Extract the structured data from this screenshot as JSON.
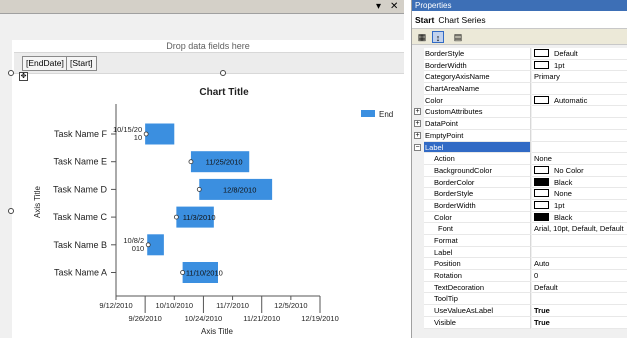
{
  "designer": {
    "drop_zone_text": "Drop data fields here",
    "fields": [
      "[EndDate]",
      "[Start]"
    ],
    "topbar_icons": {
      "dropdown": "▾",
      "close": "✕"
    }
  },
  "chart_data": {
    "type": "bar",
    "title": "Chart Title",
    "xlabel": "Axis Title",
    "ylabel": "Axis Title",
    "legend": {
      "position": "top-right",
      "entries": [
        "End"
      ]
    },
    "categories": [
      "Task Name F",
      "Task Name E",
      "Task Name D",
      "Task Name C",
      "Task Name B",
      "Task Name A"
    ],
    "series": [
      {
        "name": "End",
        "color": "#3b8fe0",
        "ranges": [
          {
            "start": "2010-09-26",
            "end": "2010-10-10",
            "label": "10/15/20\n10"
          },
          {
            "start": "2010-10-18",
            "end": "2010-11-15",
            "label": "11/25/2010"
          },
          {
            "start": "2010-10-22",
            "end": "2010-11-26",
            "label": "12/8/2010"
          },
          {
            "start": "2010-10-11",
            "end": "2010-10-29",
            "label": "11/3/2010"
          },
          {
            "start": "2010-09-27",
            "end": "2010-10-05",
            "label": "10/8/2\n010"
          },
          {
            "start": "2010-10-14",
            "end": "2010-10-31",
            "label": "11/10/2010"
          }
        ]
      }
    ],
    "x_ticks_top": [
      "9/12/2010",
      "10/10/2010",
      "11/7/2010",
      "12/5/2010"
    ],
    "x_ticks_bottom": [
      "9/26/2010",
      "10/24/2010",
      "11/21/2010",
      "12/19/2010"
    ],
    "xlim": [
      "2010-09-12",
      "2010-12-19"
    ],
    "grid": false
  },
  "properties": {
    "title": "Properties",
    "subject_name": "Start",
    "subject_type": "Chart Series",
    "toolbar": [
      "categorized",
      "alphabetical",
      "property-pages"
    ],
    "rows": [
      {
        "name": "BorderStyle",
        "value": "Default",
        "swatch": "white"
      },
      {
        "name": "BorderWidth",
        "value": "1pt",
        "swatch": "white"
      },
      {
        "name": "CategoryAxisName",
        "value": "Primary"
      },
      {
        "name": "ChartAreaName",
        "value": ""
      },
      {
        "name": "Color",
        "value": "Automatic",
        "swatch": "white"
      },
      {
        "name": "CustomAttributes",
        "value": "",
        "expander": "+"
      },
      {
        "name": "DataPoint",
        "value": "",
        "expander": "+"
      },
      {
        "name": "EmptyPoint",
        "value": "",
        "expander": "+"
      },
      {
        "name": "Label",
        "value": "",
        "expander": "−",
        "selected": true
      },
      {
        "name": "Action",
        "value": "None",
        "child": true
      },
      {
        "name": "BackgroundColor",
        "value": "No Color",
        "swatch": "white",
        "child": true
      },
      {
        "name": "BorderColor",
        "value": "Black",
        "swatch": "black",
        "child": true
      },
      {
        "name": "BorderStyle",
        "value": "None",
        "swatch": "white",
        "child": true
      },
      {
        "name": "BorderWidth",
        "value": "1pt",
        "swatch": "white",
        "child": true
      },
      {
        "name": "Color",
        "value": "Black",
        "swatch": "black",
        "child": true
      },
      {
        "name": "Font",
        "value": "Arial, 10pt, Default, Default",
        "expander": "+",
        "child": true
      },
      {
        "name": "Format",
        "value": "",
        "child": true
      },
      {
        "name": "Label",
        "value": "",
        "child": true
      },
      {
        "name": "Position",
        "value": "Auto",
        "child": true
      },
      {
        "name": "Rotation",
        "value": "0",
        "child": true
      },
      {
        "name": "TextDecoration",
        "value": "Default",
        "child": true
      },
      {
        "name": "ToolTip",
        "value": "",
        "child": true
      },
      {
        "name": "UseValueAsLabel",
        "value": "True",
        "child": true,
        "bold": true
      },
      {
        "name": "Visible",
        "value": "True",
        "child": true,
        "bold": true
      }
    ]
  }
}
